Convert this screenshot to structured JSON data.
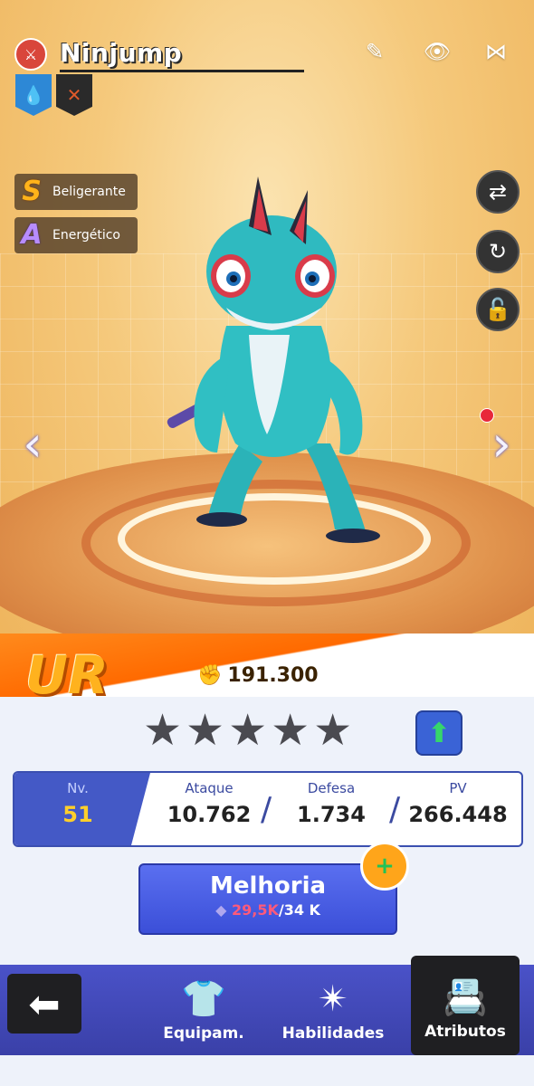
{
  "pokemon": {
    "name": "Ninjump",
    "types": [
      "water",
      "fighting"
    ]
  },
  "header": {
    "edit_icon": "edit-icon",
    "view_icon": "eye-icon",
    "share_icon": "share-icon"
  },
  "traits": [
    {
      "grade": "S",
      "label": "Beligerante"
    },
    {
      "grade": "A",
      "label": "Energético"
    }
  ],
  "rank": "UR",
  "power": "191.300",
  "stats": {
    "level": {
      "label": "Nv.",
      "value": "51"
    },
    "attack": {
      "label": "Ataque",
      "value": "10.762"
    },
    "defense": {
      "label": "Defesa",
      "value": "1.734"
    },
    "hp": {
      "label": "PV",
      "value": "266.448"
    }
  },
  "improve": {
    "label": "Melhoria",
    "have": "29,5K",
    "need": "/34 K"
  },
  "nav": {
    "equip": "Equipam.",
    "skills": "Habilidades",
    "attributes": "Atributos"
  },
  "colors": {
    "accent_blue": "#4459c6",
    "rank_gold": "#ffb21e",
    "level_yellow": "#ffcf2a"
  }
}
